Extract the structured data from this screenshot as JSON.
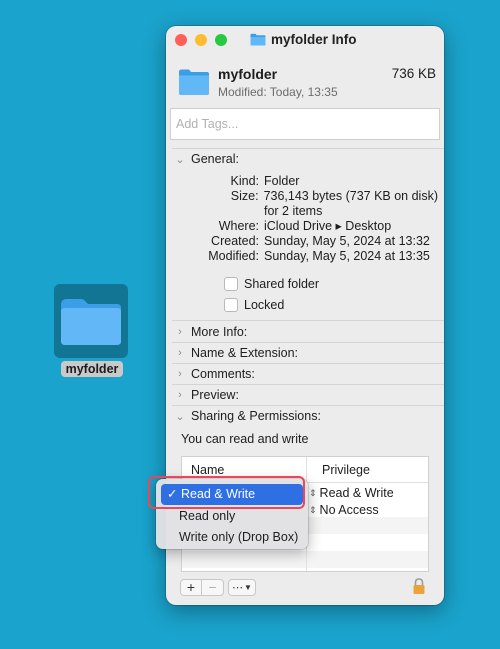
{
  "desktop": {
    "icon_name": "folder-icon",
    "label": "myfolder"
  },
  "window": {
    "title": "myfolder Info",
    "name": "myfolder",
    "size": "736 KB",
    "modified": "Modified: Today, 13:35",
    "tags_placeholder": "Add Tags..."
  },
  "general": {
    "header": "General:",
    "kind_label": "Kind:",
    "kind": "Folder",
    "size_label": "Size:",
    "size": "736,143 bytes (737 KB on disk)",
    "items": "for 2 items",
    "where_label": "Where:",
    "where": "iCloud Drive ▸ Desktop",
    "created_label": "Created:",
    "created": "Sunday, May 5, 2024 at 13:32",
    "modified_label": "Modified:",
    "modified": "Sunday, May 5, 2024 at 13:35",
    "shared_folder": "Shared folder",
    "locked": "Locked"
  },
  "sections": {
    "more_info": "More Info:",
    "name_extension": "Name & Extension:",
    "comments": "Comments:",
    "preview": "Preview:",
    "sharing": "Sharing & Permissions:"
  },
  "permissions": {
    "summary": "You can read and write",
    "col_name": "Name",
    "col_privilege": "Privilege",
    "rows": [
      {
        "privilege": "Read & Write"
      },
      {
        "privilege": "No Access"
      }
    ]
  },
  "menu": {
    "items": [
      "Read & Write",
      "Read only",
      "Write only (Drop Box)"
    ],
    "selected_index": 0,
    "check": "✓"
  },
  "colors": {
    "accent": "#2f6fe4",
    "highlight": "#e8485a",
    "desktop": "#1aa3cc"
  }
}
